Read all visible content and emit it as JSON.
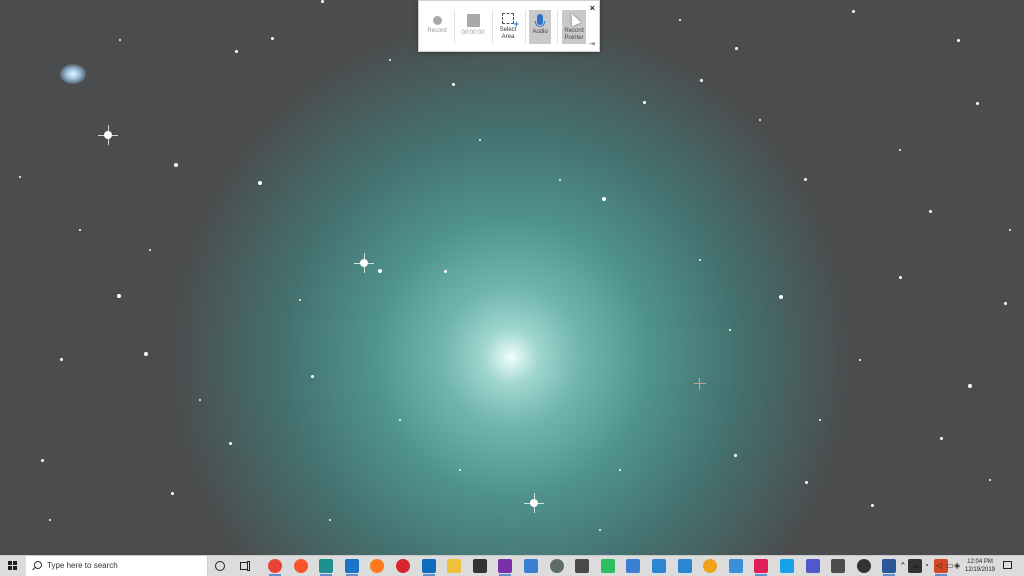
{
  "recorder": {
    "record_label": "Record",
    "timer": "00:00:00",
    "select_area_label": "Select\nArea",
    "audio_label": "Audio",
    "record_pointer_label": "Record\nPointer",
    "close_glyph": "×",
    "pin_glyph": "⇥"
  },
  "taskbar": {
    "search_placeholder": "Type here to search",
    "apps": [
      {
        "name": "chrome-icon",
        "color": "#e94335"
      },
      {
        "name": "brave-icon",
        "color": "#fb542b"
      },
      {
        "name": "edge-dev-icon",
        "color": "#1f8f8f"
      },
      {
        "name": "edge-icon",
        "color": "#1a73c7"
      },
      {
        "name": "firefox-icon",
        "color": "#ff7a1a"
      },
      {
        "name": "opera-icon",
        "color": "#d8242c"
      },
      {
        "name": "outlook-icon",
        "color": "#0f6cbd"
      },
      {
        "name": "file-explorer-icon",
        "color": "#f0c13a"
      },
      {
        "name": "store-icon",
        "color": "#333333"
      },
      {
        "name": "onenote-icon",
        "color": "#7b2fa8"
      },
      {
        "name": "notion-icon",
        "color": "#3b7fd3"
      },
      {
        "name": "app-circle-icon",
        "color": "#5e6d6b"
      },
      {
        "name": "sticky-icon",
        "color": "#4a4a4a"
      },
      {
        "name": "evernote-icon",
        "color": "#2dbe60"
      },
      {
        "name": "grid-app-icon",
        "color": "#3b7fd3"
      },
      {
        "name": "people-icon",
        "color": "#2a86d5"
      },
      {
        "name": "checkmark-icon",
        "color": "#2a86d5"
      },
      {
        "name": "coin-icon",
        "color": "#f0a21a"
      },
      {
        "name": "blue-square-icon",
        "color": "#3b8fd9"
      },
      {
        "name": "slack-icon",
        "color": "#e01e5a"
      },
      {
        "name": "skype-icon",
        "color": "#16a2e6"
      },
      {
        "name": "teams-icon",
        "color": "#5059c9"
      },
      {
        "name": "calculator-icon",
        "color": "#4d4d4d"
      },
      {
        "name": "obs-icon",
        "color": "#333333"
      },
      {
        "name": "word-icon",
        "color": "#2b5797"
      },
      {
        "name": "settings-icon",
        "color": "#333333"
      },
      {
        "name": "powerpoint-icon",
        "color": "#d24726"
      }
    ],
    "tray": {
      "chevron": "^",
      "clock_time": "12:04 PM",
      "clock_date": "12/19/2019"
    }
  }
}
